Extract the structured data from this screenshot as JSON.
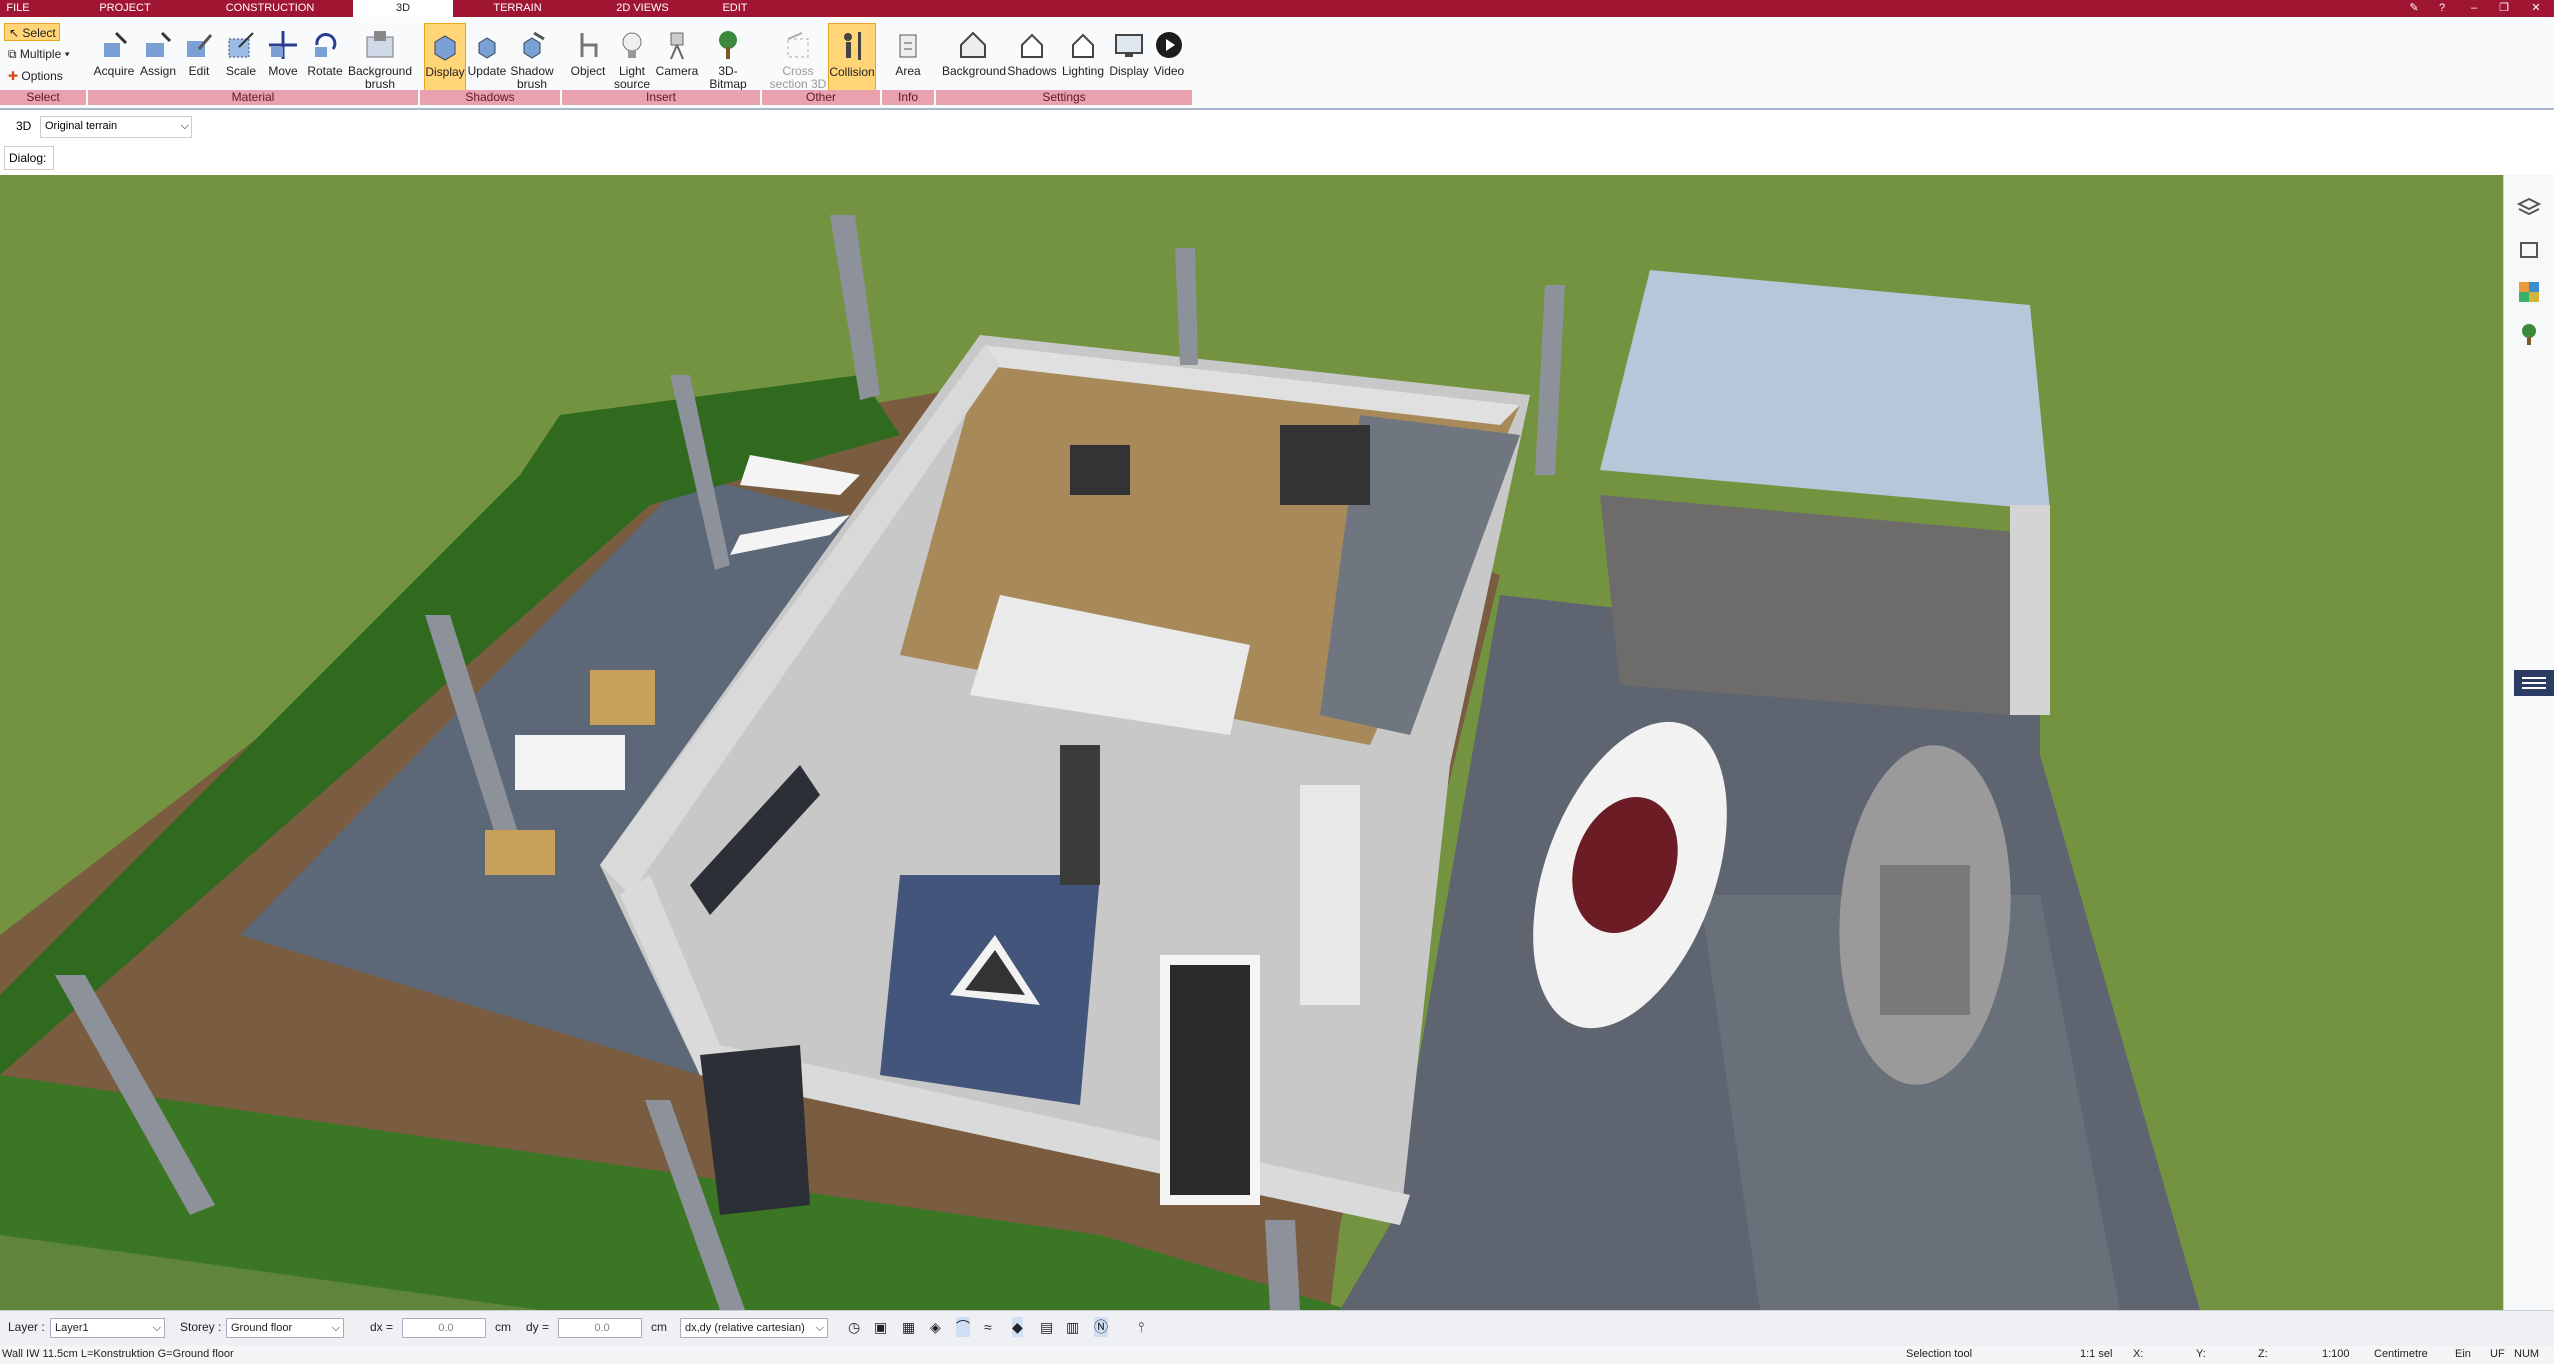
{
  "tabs": [
    {
      "label": "FILE"
    },
    {
      "label": "PROJECT"
    },
    {
      "label": "CONSTRUCTION"
    },
    {
      "label": "3D"
    },
    {
      "label": "TERRAIN"
    },
    {
      "label": "2D VIEWS"
    },
    {
      "label": "EDIT"
    }
  ],
  "select_group": {
    "select": "Select",
    "multiple": "Multiple",
    "options": "Options",
    "group": "Select"
  },
  "ribbon_buttons": [
    {
      "label": "Acquire",
      "sub": ""
    },
    {
      "label": "Assign",
      "sub": ""
    },
    {
      "label": "Edit",
      "sub": ""
    },
    {
      "label": "Scale",
      "sub": ""
    },
    {
      "label": "Move",
      "sub": ""
    },
    {
      "label": "Rotate",
      "sub": ""
    },
    {
      "label": "Background",
      "sub": "brush"
    },
    {
      "label": "Display",
      "sub": ""
    },
    {
      "label": "Update",
      "sub": ""
    },
    {
      "label": "Shadow",
      "sub": "brush"
    },
    {
      "label": "Object",
      "sub": ""
    },
    {
      "label": "Light",
      "sub": "source"
    },
    {
      "label": "Camera",
      "sub": ""
    },
    {
      "label": "3D-Bitmap",
      "sub": ""
    },
    {
      "label": "Cross",
      "sub": "section 3D"
    },
    {
      "label": "Collision",
      "sub": ""
    },
    {
      "label": "Area",
      "sub": ""
    },
    {
      "label": "Background",
      "sub": ""
    },
    {
      "label": "Shadows",
      "sub": ""
    },
    {
      "label": "Lighting",
      "sub": ""
    },
    {
      "label": "Display",
      "sub": ""
    },
    {
      "label": "Video",
      "sub": ""
    }
  ],
  "groups": [
    {
      "label": "Material"
    },
    {
      "label": "Shadows"
    },
    {
      "label": "Insert"
    },
    {
      "label": "Other"
    },
    {
      "label": "Info"
    },
    {
      "label": "Settings"
    }
  ],
  "viewbar": {
    "mode": "3D",
    "terrain": "Original terrain"
  },
  "dialog": {
    "label": "Dialog:"
  },
  "status": {
    "layer_label": "Layer :",
    "layer_value": "Layer1",
    "storey_label": "Storey :",
    "storey_value": "Ground floor",
    "dx_label": "dx =",
    "dx_value": "0.0",
    "dx_unit": "cm",
    "dy_label": "dy =",
    "dy_value": "0.0",
    "dy_unit": "cm",
    "coord_mode": "dx,dy (relative cartesian)"
  },
  "footer": {
    "info": "Wall IW 11.5cm L=Konstruktion G=Ground floor",
    "tool": "Selection tool",
    "sel": "1:1 sel",
    "x": "X:",
    "y": "Y:",
    "z": "Z:",
    "scale": "1:100",
    "unit": "Centimetre",
    "ein": "Ein",
    "uf": "UF",
    "num": "NUM"
  },
  "colors": {
    "brand": "#a01632",
    "group_bar": "#e9a1b0",
    "active_button": "#ffd577",
    "grass": "#6f8f3e",
    "paving": "#5f6570"
  }
}
